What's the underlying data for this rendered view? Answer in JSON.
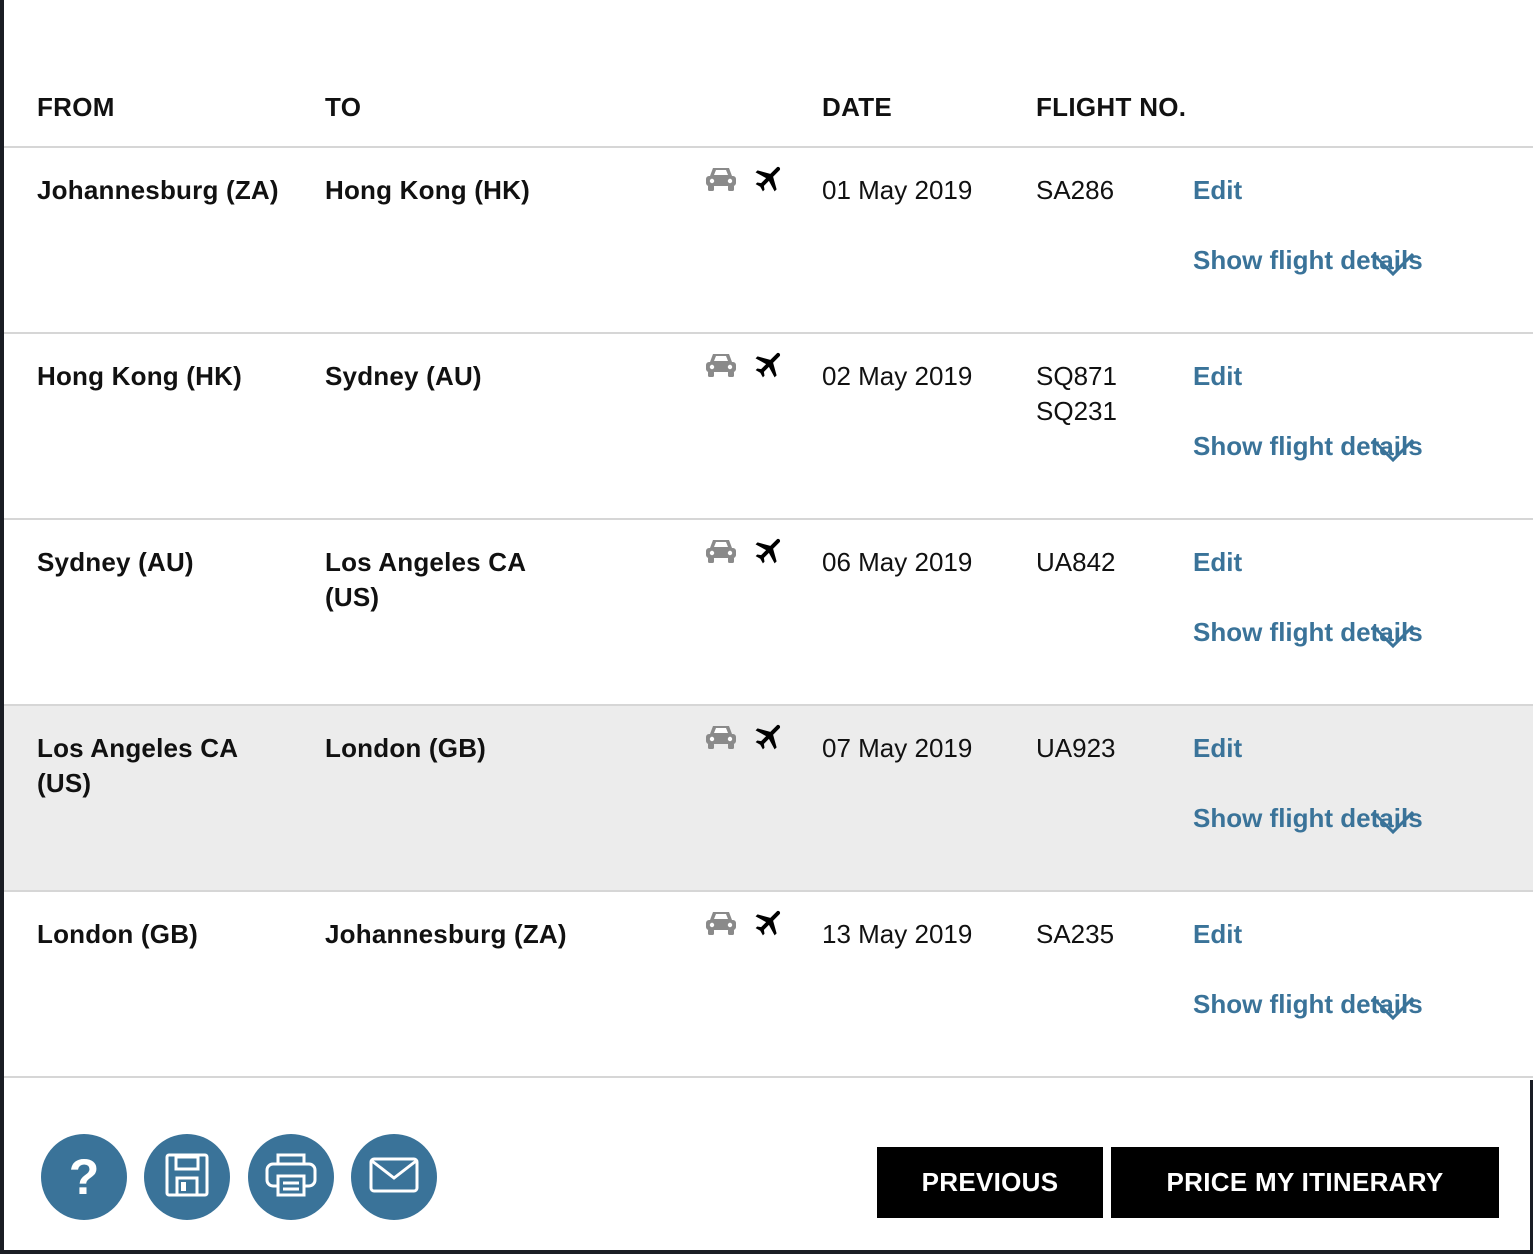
{
  "header": {
    "from": "FROM",
    "to": "TO",
    "date": "DATE",
    "flight_no": "FLIGHT NO."
  },
  "rows": [
    {
      "from": "Johannesburg (ZA)",
      "to": "Hong Kong (HK)",
      "date": "01 May 2019",
      "flights": [
        "SA286"
      ],
      "edit": "Edit",
      "details": "Show flight details",
      "highlighted": false
    },
    {
      "from": "Hong Kong (HK)",
      "to": "Sydney (AU)",
      "date": "02 May 2019",
      "flights": [
        "SQ871",
        "SQ231"
      ],
      "edit": "Edit",
      "details": "Show flight details",
      "highlighted": false
    },
    {
      "from": "Sydney (AU)",
      "to": "Los Angeles CA (US)",
      "date": "06 May 2019",
      "flights": [
        "UA842"
      ],
      "edit": "Edit",
      "details": "Show flight details",
      "highlighted": false
    },
    {
      "from": "Los Angeles CA (US)",
      "to": "London (GB)",
      "date": "07 May 2019",
      "flights": [
        "UA923"
      ],
      "edit": "Edit",
      "details": "Show flight details",
      "highlighted": true
    },
    {
      "from": "London (GB)",
      "to": "Johannesburg (ZA)",
      "date": "13 May 2019",
      "flights": [
        "SA235"
      ],
      "edit": "Edit",
      "details": "Show flight details",
      "highlighted": false
    }
  ],
  "row_icons": [
    "car-icon",
    "plane-icon"
  ],
  "toolbar": {
    "icons": [
      "help-icon",
      "save-icon",
      "print-icon",
      "email-icon"
    ],
    "help_glyph": "?"
  },
  "buttons": {
    "previous": "PREVIOUS",
    "price": "PRICE MY ITINERARY"
  },
  "colors": {
    "accent": "#3a7399",
    "highlight_row": "#ececec",
    "button_bg": "#000000",
    "icon_gray": "#8a8a8a"
  }
}
